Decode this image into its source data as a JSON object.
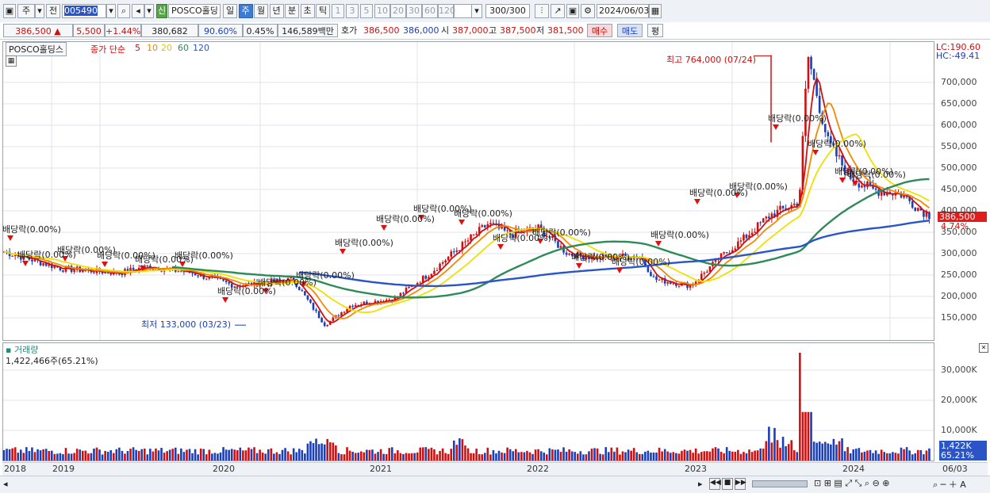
{
  "toolbar": {
    "period_label": "주",
    "prev_label": "전",
    "stock_code": "005490",
    "stock_name": "POSCO홀딩스",
    "new_badge": "신",
    "tabs": [
      "일",
      "주",
      "월",
      "년",
      "분",
      "초",
      "틱"
    ],
    "minute_options": [
      "1",
      "3",
      "5",
      "10",
      "20",
      "30",
      "60",
      "120"
    ],
    "count_value": "300/300",
    "date_value": "2024/06/03"
  },
  "quote": {
    "price": "386,500",
    "change": "5,500",
    "change_pct": "+1.44%",
    "volume": "380,682",
    "vol_ratio": "90.60%",
    "turnover": "0.45%",
    "amount": "146,589백만",
    "ask_label": "호가",
    "ask": "386,500",
    "bid": "386,000",
    "open_label": "시",
    "open": "387,000",
    "high_label": "고",
    "high": "387,500",
    "low_label": "저",
    "low": "381,500",
    "buy_label": "매수",
    "sell_label": "매도",
    "eval_label": "평"
  },
  "chart_header": {
    "name": "POSCO홀딩스",
    "ma_label": "종가 단순",
    "ma_periods": [
      "5",
      "10",
      "20",
      "60",
      "120"
    ],
    "lc": "LC:190.60",
    "hc": "HC:-49.41",
    "current_price": "386,500",
    "current_pct": "4.74%",
    "high_label": "최고 764,000 (07/24)",
    "low_label": "최저 133,000 (03/23)",
    "dividend_label": "배당락(0.00%)"
  },
  "volume_panel": {
    "title": "거래량",
    "value": "1,422,466주(65.21%)",
    "current": "1,422K",
    "current_pct": "65.21%"
  },
  "chart_data": {
    "type": "line",
    "title": "POSCO홀딩스 주봉",
    "x_labels": [
      "2018",
      "2019",
      "2020",
      "2021",
      "2022",
      "2023",
      "2024",
      "06/03"
    ],
    "y_ticks": [
      "700,000",
      "650,000",
      "600,000",
      "550,000",
      "500,000",
      "450,000",
      "400,000",
      "350,000",
      "300,000",
      "250,000",
      "200,000",
      "150,000"
    ],
    "vol_ticks": [
      "30,000K",
      "20,000K",
      "10,000K"
    ],
    "ylim": [
      100000,
      780000
    ],
    "series": [
      {
        "name": "5",
        "color": "#d01010"
      },
      {
        "name": "10",
        "color": "#f08a00"
      },
      {
        "name": "20",
        "color": "#f0e000"
      },
      {
        "name": "60",
        "color": "#2e8b57"
      },
      {
        "name": "120",
        "color": "#2b55c7"
      }
    ],
    "price_points": [
      [
        2018.0,
        305000
      ],
      [
        2018.4,
        265000
      ],
      [
        2018.8,
        255000
      ],
      [
        2019.0,
        270000
      ],
      [
        2019.3,
        255000
      ],
      [
        2019.6,
        225000
      ],
      [
        2019.9,
        235000
      ],
      [
        2020.0,
        240000
      ],
      [
        2020.22,
        133000
      ],
      [
        2020.4,
        180000
      ],
      [
        2020.7,
        195000
      ],
      [
        2020.95,
        255000
      ],
      [
        2021.1,
        300000
      ],
      [
        2021.35,
        370000
      ],
      [
        2021.5,
        345000
      ],
      [
        2021.7,
        360000
      ],
      [
        2021.9,
        300000
      ],
      [
        2022.1,
        290000
      ],
      [
        2022.4,
        295000
      ],
      [
        2022.5,
        240000
      ],
      [
        2022.75,
        225000
      ],
      [
        2022.95,
        290000
      ],
      [
        2023.1,
        330000
      ],
      [
        2023.3,
        390000
      ],
      [
        2023.5,
        420000
      ],
      [
        2023.56,
        764000
      ],
      [
        2023.7,
        560000
      ],
      [
        2023.85,
        480000
      ],
      [
        2024.0,
        450000
      ],
      [
        2024.2,
        440000
      ],
      [
        2024.35,
        400000
      ],
      [
        2024.42,
        386500
      ]
    ],
    "high": 764000,
    "low": 133000,
    "volume_peak_k": 36000
  },
  "colors": {
    "up": "#d01010",
    "down": "#1a3fb8",
    "grid": "#dfe3ea"
  }
}
